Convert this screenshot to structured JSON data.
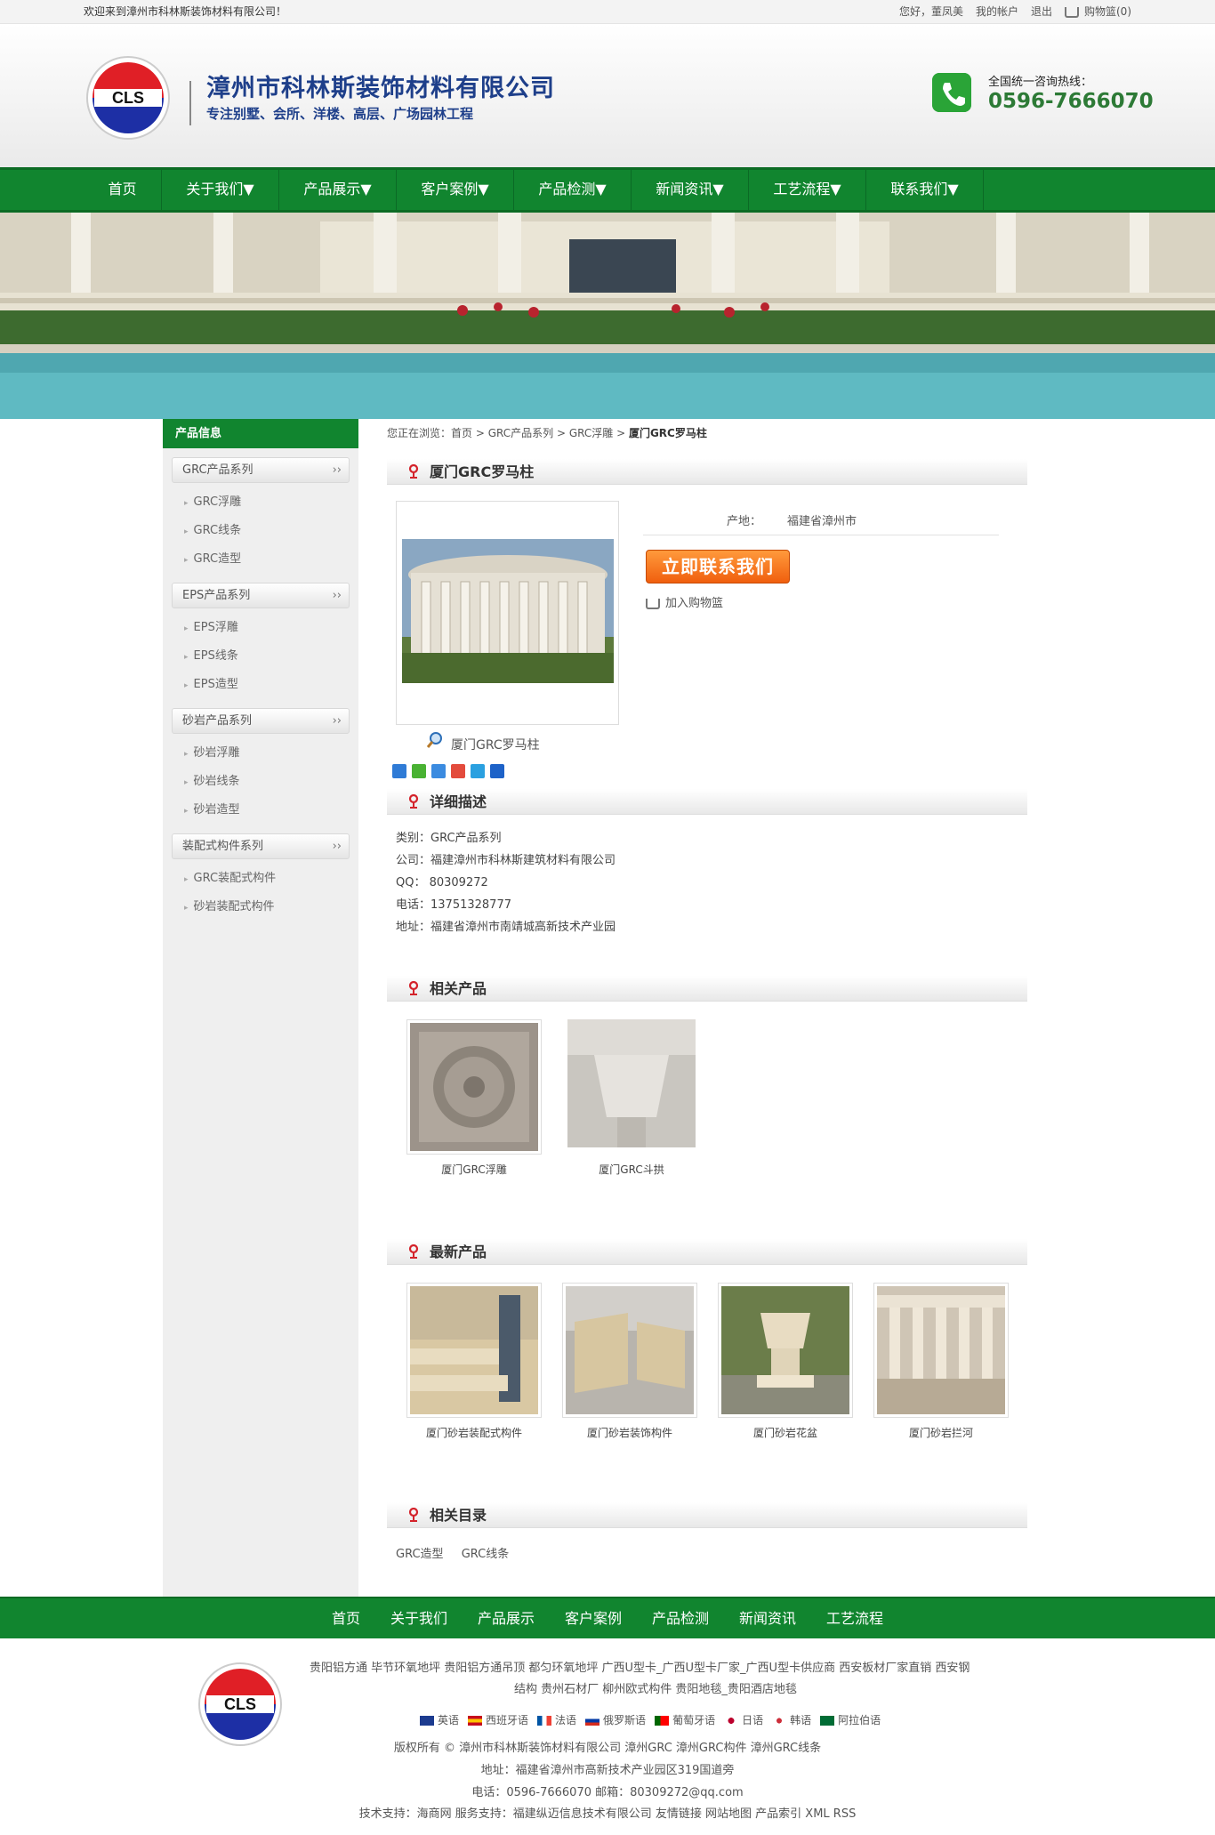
{
  "topbar": {
    "welcome": "欢迎来到漳州市科林斯装饰材料有限公司！",
    "greeting": "您好，董凤美",
    "my_account": "我的帐户",
    "logout": "退出",
    "cart": "购物篮(0)"
  },
  "header": {
    "logo_text": "CLS",
    "company": "漳州市科林斯装饰材料有限公司",
    "slogan": "专注别墅、会所、洋楼、高层、广场园林工程",
    "hotline_label": "全国统一咨询热线：",
    "hotline": "0596-7666070"
  },
  "nav": [
    "首页",
    "关于我们▼",
    "产品展示▼",
    "客户案例▼",
    "产品检测▼",
    "新闻资讯▼",
    "工艺流程▼",
    "联系我们▼"
  ],
  "sidebar": {
    "title": "产品信息",
    "groups": [
      {
        "name": "GRC产品系列",
        "items": [
          "GRC浮雕",
          "GRC线条",
          "GRC造型"
        ]
      },
      {
        "name": "EPS产品系列",
        "items": [
          "EPS浮雕",
          "EPS线条",
          "EPS造型"
        ]
      },
      {
        "name": "砂岩产品系列",
        "items": [
          "砂岩浮雕",
          "砂岩线条",
          "砂岩造型"
        ]
      },
      {
        "name": "装配式构件系列",
        "items": [
          "GRC装配式构件",
          "砂岩装配式构件"
        ]
      }
    ]
  },
  "breadcrumb": {
    "prefix": "您正在浏览：",
    "items": [
      "首页",
      "GRC产品系列",
      "GRC浮雕"
    ],
    "current": "厦门GRC罗马柱",
    "sep": " > "
  },
  "product": {
    "title": "厦门GRC罗马柱",
    "origin_label": "产地：",
    "origin_value": "福建省漳州市",
    "contact_button": "立即联系我们",
    "add_to_cart": "加入购物篮",
    "image_caption": "厦门GRC罗马柱"
  },
  "detail": {
    "title": "详细描述",
    "lines": [
      "类别：GRC产品系列",
      "公司：福建漳州市科林斯建筑材料有限公司",
      "QQ：  80309272",
      "电话：13751328777",
      "地址：福建省漳州市南靖城高新技术产业园"
    ]
  },
  "related": {
    "title": "相关产品",
    "items": [
      "厦门GRC浮雕",
      "厦门GRC斗拱"
    ]
  },
  "latest": {
    "title": "最新产品",
    "items": [
      "厦门砂岩装配式构件",
      "厦门砂岩装饰构件",
      "厦门砂岩花盆",
      "厦门砂岩拦河"
    ]
  },
  "catalog": {
    "title": "相关目录",
    "items": [
      "GRC造型",
      "GRC线条"
    ]
  },
  "footer_nav": [
    "首页",
    "关于我们",
    "产品展示",
    "客户案例",
    "产品检测",
    "新闻资讯",
    "工艺流程"
  ],
  "footer": {
    "links_line1": "贵阳铝方通 毕节环氧地坪 贵阳铝方通吊顶 都匀环氧地坪 广西U型卡_广西U型卡厂家_广西U型卡供应商 西安板材厂家直销 西安钢",
    "links_line2": "结构 贵州石材厂 柳州欧式构件 贵阳地毯_贵阳酒店地毯",
    "languages": [
      "英语",
      "西班牙语",
      "法语",
      "俄罗斯语",
      "葡萄牙语",
      "日语",
      "韩语",
      "阿拉伯语"
    ],
    "copyright": "版权所有 © 漳州市科林斯装饰材料有限公司 漳州GRC 漳州GRC构件 漳州GRC线条",
    "address": "地址：福建省漳州市高新技术产业园区319国道旁",
    "contact": "电话：0596-7666070 邮箱：80309272@qq.com",
    "support": "技术支持：海商网 服务支持：福建纵迈信息技术有限公司 友情链接 网站地图 产品索引 XML RSS"
  },
  "colors": {
    "brand_green": "#11852f",
    "brand_blue": "#1e3f8a",
    "accent_orange": "#f05f0e"
  }
}
